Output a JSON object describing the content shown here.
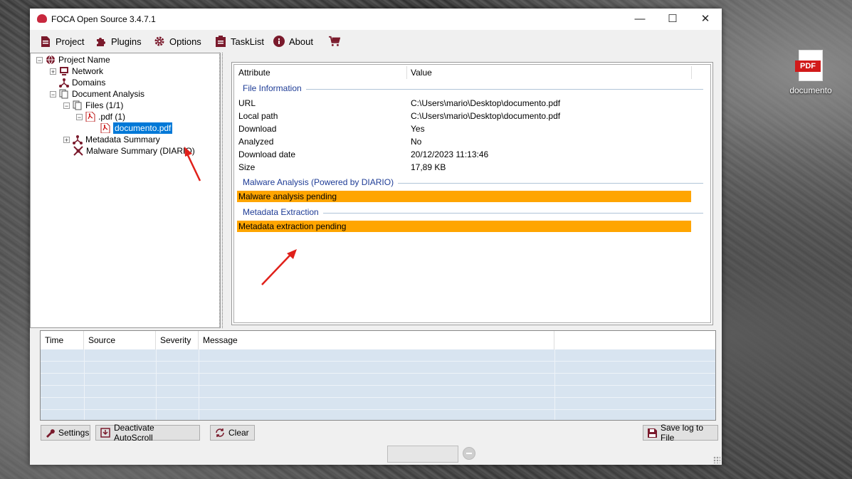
{
  "desktop": {
    "icon_badge": "PDF",
    "icon_label": "documento"
  },
  "window": {
    "title": "FOCA Open Source 3.4.7.1",
    "controls": {
      "minimize": "—",
      "maximize": "☐",
      "close": "✕"
    }
  },
  "menu": [
    {
      "label": "Project",
      "icon": "document-icon"
    },
    {
      "label": "Plugins",
      "icon": "puzzle-icon"
    },
    {
      "label": "Options",
      "icon": "gear-icon"
    },
    {
      "label": "TaskList",
      "icon": "clipboard-icon"
    },
    {
      "label": "About",
      "icon": "info-icon"
    },
    {
      "label": "",
      "icon": "cart-icon"
    }
  ],
  "tree": {
    "root": "Project Name",
    "network": "Network",
    "domains": "Domains",
    "document_analysis": "Document Analysis",
    "files": "Files (1/1)",
    "pdf_group": ".pdf (1)",
    "selected_file": "documento.pdf",
    "metadata_summary": "Metadata Summary",
    "malware_summary": "Malware Summary (DIARIO)"
  },
  "details": {
    "col_attribute": "Attribute",
    "col_value": "Value",
    "group_file": "File Information",
    "rows": [
      {
        "attr": "URL",
        "value": "C:\\Users\\mario\\Desktop\\documento.pdf"
      },
      {
        "attr": "Local path",
        "value": "C:\\Users\\mario\\Desktop\\documento.pdf"
      },
      {
        "attr": "Download",
        "value": "Yes"
      },
      {
        "attr": "Analyzed",
        "value": "No"
      },
      {
        "attr": "Download date",
        "value": "20/12/2023 11:13:46"
      },
      {
        "attr": "Size",
        "value": "17,89 KB"
      }
    ],
    "group_malware": "Malware Analysis (Powered by DIARIO)",
    "malware_status": "Malware analysis pending",
    "group_metadata": "Metadata Extraction",
    "metadata_status": "Metadata extraction pending",
    "pending_color": "#ffa500"
  },
  "log": {
    "columns": [
      "Time",
      "Source",
      "Severity",
      "Message",
      ""
    ],
    "rows": []
  },
  "buttons": {
    "settings": "Settings",
    "autoscroll": "Deactivate AutoScroll",
    "clear": "Clear",
    "save_log": "Save log to File"
  }
}
